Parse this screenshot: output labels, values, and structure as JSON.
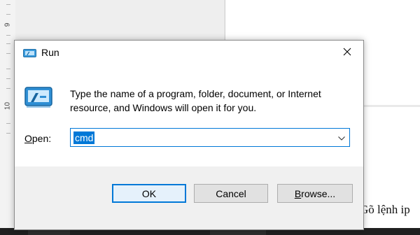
{
  "background": {
    "ruler_numbers": [
      "9",
      "10"
    ],
    "document_text": "Gõ lệnh ip"
  },
  "dialog": {
    "title": "Run",
    "description_line1": "Type the name of a program, folder, document, or Internet",
    "description_line2": "resource, and Windows will open it for you.",
    "open_label_mnemonic": "O",
    "open_label_rest": "pen:",
    "open_value": "cmd",
    "buttons": {
      "ok": "OK",
      "cancel": "Cancel",
      "browse_mnemonic": "B",
      "browse_rest": "rowse..."
    }
  },
  "icons": {
    "title": "run-icon",
    "close": "close-icon",
    "large": "run-large-icon",
    "caret": "chevron-down-icon"
  },
  "colors": {
    "accent": "#0078d7",
    "button_band": "#f0f0f0",
    "button_face": "#e1e1e1"
  }
}
